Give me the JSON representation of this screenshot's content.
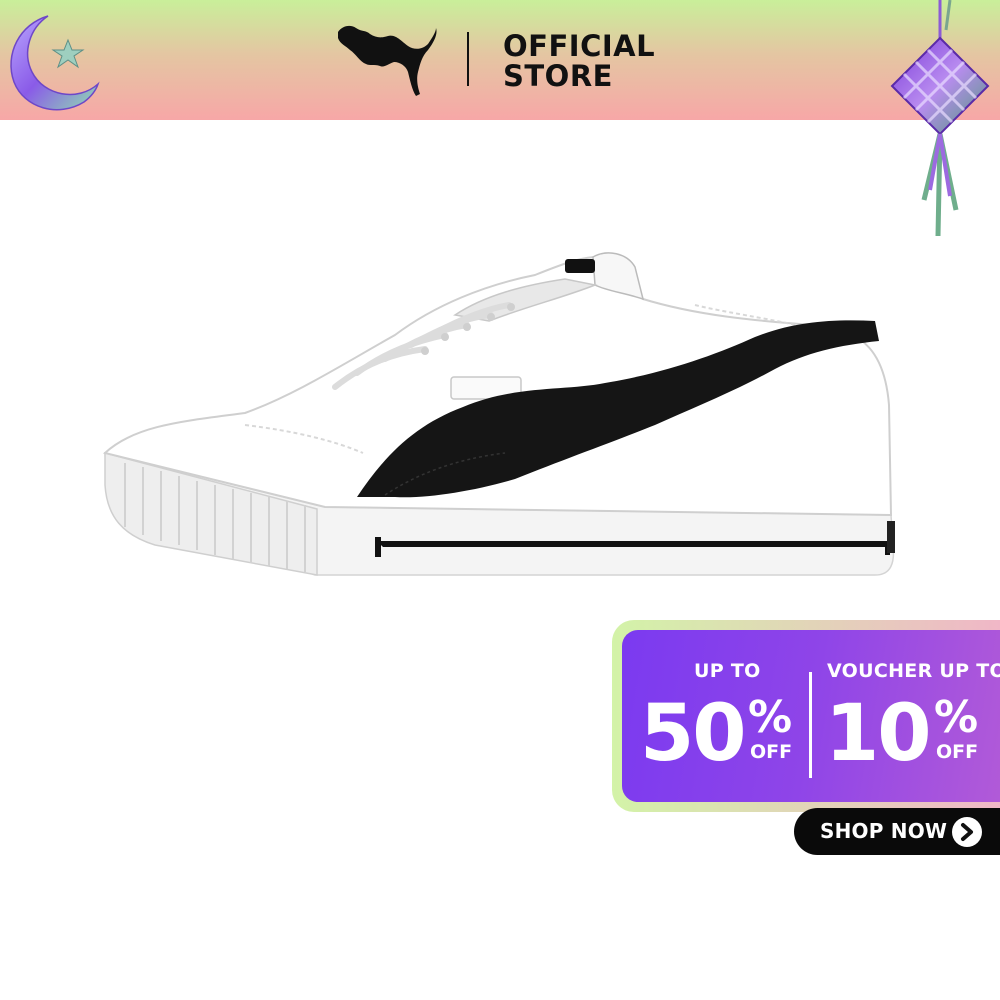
{
  "header": {
    "brand": "PUMA",
    "store_line1": "OFFICIAL",
    "store_line2": "STORE",
    "logo_icon": "puma-cat-icon",
    "gradient_top": "#c9ef9a",
    "gradient_bottom": "#f7a7a7"
  },
  "decorations": {
    "left": "crescent-moon-star-icon",
    "right": "ketupat-icon"
  },
  "product": {
    "image": "white-sneaker-black-stripe"
  },
  "promo": {
    "left_top": "UP TO",
    "left_big": "50",
    "left_pct": "%",
    "left_off": "OFF",
    "right_top": "VOUCHER UP TO",
    "right_big": "10",
    "right_pct": "%",
    "right_off": "OFF",
    "accent": "#7b3af0"
  },
  "cta": {
    "label": "SHOP NOW",
    "icon": "chevron-right-icon"
  }
}
